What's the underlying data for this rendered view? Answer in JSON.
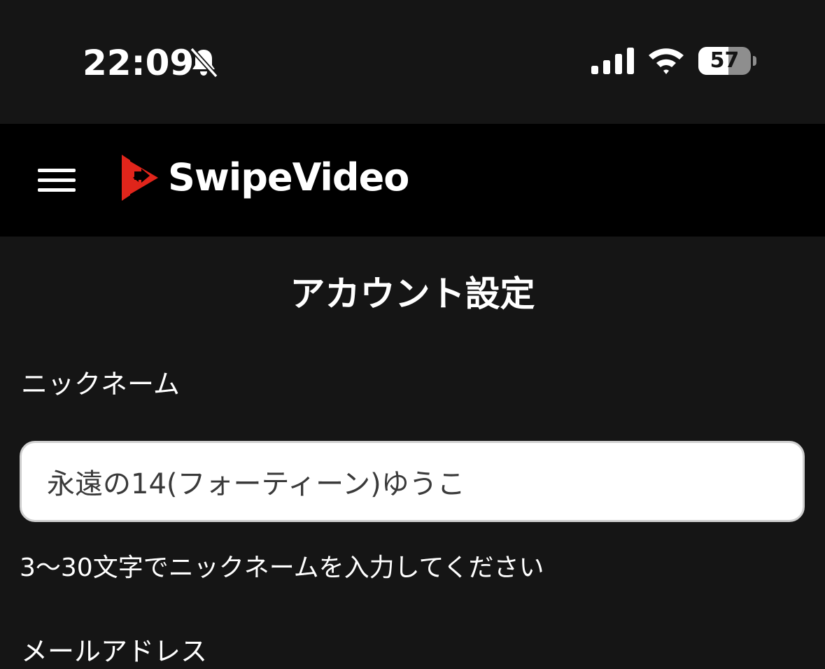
{
  "status_bar": {
    "time": "22:09",
    "bell_icon": "bell-slash-icon",
    "signal_icon": "cellular-signal-icon",
    "wifi_icon": "wifi-icon",
    "battery_level": "57",
    "battery_fraction": 0.57
  },
  "header": {
    "menu_icon": "hamburger-menu-icon",
    "logo_icon": "swipevideo-logo-icon",
    "brand_name": "SwipeVideo",
    "brand_color": "#e0251b"
  },
  "main": {
    "title": "アカウント設定",
    "nickname_label": "ニックネーム",
    "nickname_value": "永遠の14(フォーティーン)ゆうこ",
    "nickname_helper": "3〜30文字でニックネームを入力してください",
    "next_section_label": "メールアドレス"
  },
  "colors": {
    "background": "#151515",
    "header_background": "#000000",
    "text": "#ffffff",
    "input_background": "#ffffff"
  }
}
